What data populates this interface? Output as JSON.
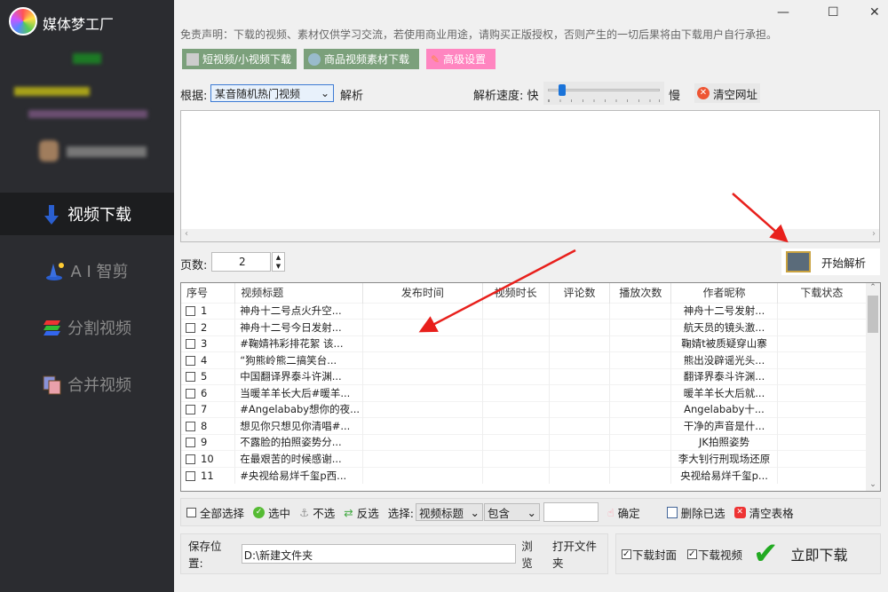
{
  "app": {
    "name": "媒体梦工厂"
  },
  "sidebar": {
    "items": [
      {
        "label": "视频下载",
        "icon": "download-arrow-icon"
      },
      {
        "label": "A I 智剪",
        "icon": "wizard-icon"
      },
      {
        "label": "分割视频",
        "icon": "layers-icon"
      },
      {
        "label": "合并视频",
        "icon": "merge-icon"
      }
    ]
  },
  "window": {
    "minimize": "—",
    "maximize": "☐",
    "close": "✕"
  },
  "disclaimer": "免责声明：下载的视频、素材仅供学习交流，若使用商业用途，请购买正版授权，否则产生的一切后果将由下载用户自行承担。",
  "toolbar": {
    "short_video": "短视频/小视频下载",
    "product_video": "商品视频素材下载",
    "advanced": "高级设置"
  },
  "parse": {
    "basis_label": "根据:",
    "basis_value": "某音随机热门视频",
    "parse_label": "解析",
    "speed_label": "解析速度: 快",
    "speed_slow": "慢",
    "speed_value": 0.1,
    "clear_url": "清空网址"
  },
  "pages": {
    "label": "页数:",
    "value": "2",
    "start": "开始解析"
  },
  "table": {
    "columns": [
      "序号",
      "视频标题",
      "发布时间",
      "视频时长",
      "评论数",
      "播放次数",
      "作者昵称",
      "下载状态"
    ],
    "rows": [
      [
        "1",
        "神舟十二号点火升空...",
        "神舟十二号发射..."
      ],
      [
        "2",
        "神舟十二号今日发射...",
        "航天员的镜头激..."
      ],
      [
        "3",
        "#鞠婧祎彩排花絮 该...",
        "鞠婧t被质疑穿山寨"
      ],
      [
        "4",
        "“狗熊岭熊二搞笑台...",
        "熊出没辟谣光头..."
      ],
      [
        "5",
        "中国翻译界泰斗许渊...",
        "翻译界泰斗许渊..."
      ],
      [
        "6",
        "当暖羊羊长大后#暖羊...",
        "暖羊羊长大后就..."
      ],
      [
        "7",
        "#Angelababy想你的夜...",
        "Angelababy十..."
      ],
      [
        "8",
        "想见你只想见你清唱#...",
        "干净的声音是什..."
      ],
      [
        "9",
        "不露脸的拍照姿势分...",
        "JK拍照姿势"
      ],
      [
        "10",
        "在最艰苦的时候感谢...",
        "李大钊行刑现场还原"
      ],
      [
        "11",
        "#央视给易烊千玺p西...",
        "央视给易烊千玺p..."
      ]
    ]
  },
  "filter": {
    "select_all": "全部选择",
    "select": "选中",
    "deselect": "不选",
    "invert": "反选",
    "choose_label": "选择:",
    "field": "视频标题",
    "mode": "包含",
    "value": "",
    "confirm": "确定",
    "delete_selected": "删除已选",
    "clear_table": "清空表格"
  },
  "save": {
    "label": "保存位置:",
    "path": "D:\\新建文件夹",
    "browse": "浏览",
    "open_folder": "打开文件夹"
  },
  "download": {
    "cover": "下载封面",
    "video": "下载视频",
    "now": "立即下载",
    "cover_checked": true,
    "video_checked": true
  },
  "colors": {
    "sidebar": "#2b2c30",
    "green_btn": "#7ba07b",
    "pink_btn": "#ff85c0",
    "arrow": "#e8201c"
  }
}
